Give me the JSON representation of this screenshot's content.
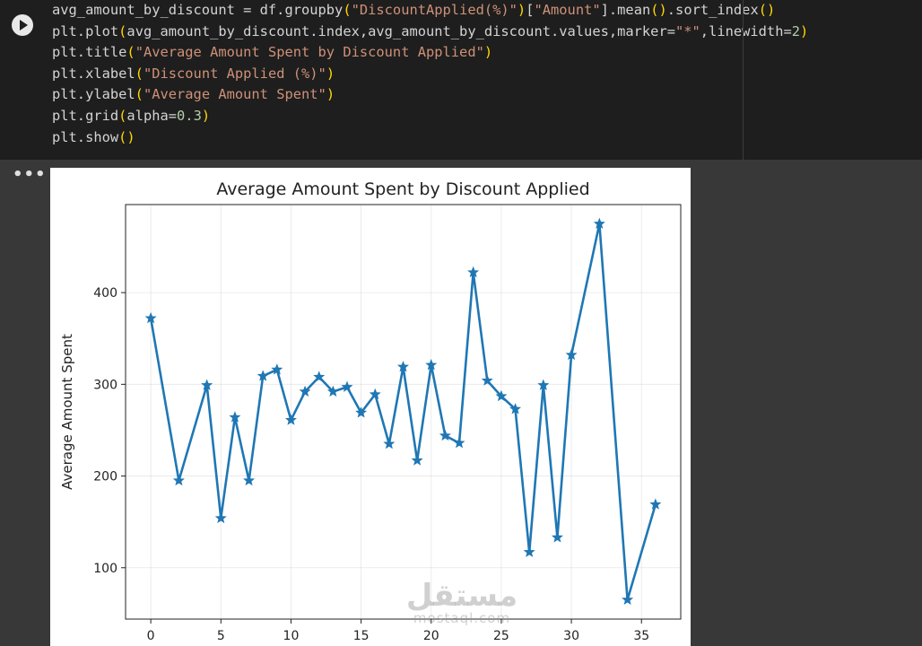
{
  "cell": {
    "code_lines": [
      [
        {
          "t": "avg_amount_by_discount = df.groupby"
        },
        {
          "t": "(",
          "c": "p1"
        },
        {
          "t": "\"DiscountApplied(%)\"",
          "c": "str"
        },
        {
          "t": ")",
          "c": "p1"
        },
        {
          "t": "["
        },
        {
          "t": "\"Amount\"",
          "c": "str"
        },
        {
          "t": "].mean"
        },
        {
          "t": "()",
          "c": "p1"
        },
        {
          "t": ".sort_index"
        },
        {
          "t": "()",
          "c": "p1"
        }
      ],
      [
        {
          "t": "plt.plot"
        },
        {
          "t": "(",
          "c": "p1"
        },
        {
          "t": "avg_amount_by_discount.index,avg_amount_by_discount.values,marker="
        },
        {
          "t": "\"*\"",
          "c": "str"
        },
        {
          "t": ",linewidth="
        },
        {
          "t": "2",
          "c": "num"
        },
        {
          "t": ")",
          "c": "p1"
        }
      ],
      [
        {
          "t": "plt.title"
        },
        {
          "t": "(",
          "c": "p1"
        },
        {
          "t": "\"Average Amount Spent by Discount Applied\"",
          "c": "str"
        },
        {
          "t": ")",
          "c": "p1"
        }
      ],
      [
        {
          "t": "plt.xlabel"
        },
        {
          "t": "(",
          "c": "p1"
        },
        {
          "t": "\"Discount Applied (%)\"",
          "c": "str"
        },
        {
          "t": ")",
          "c": "p1"
        }
      ],
      [
        {
          "t": "plt.ylabel"
        },
        {
          "t": "(",
          "c": "p1"
        },
        {
          "t": "\"Average Amount Spent\"",
          "c": "str"
        },
        {
          "t": ")",
          "c": "p1"
        }
      ],
      [
        {
          "t": "plt.grid"
        },
        {
          "t": "(",
          "c": "p1"
        },
        {
          "t": "alpha="
        },
        {
          "t": "0.3",
          "c": "num"
        },
        {
          "t": ")",
          "c": "p1"
        }
      ],
      [
        {
          "t": "plt.show"
        },
        {
          "t": "()",
          "c": "p1"
        }
      ]
    ]
  },
  "output": {
    "more_label": "•••",
    "watermark_ar": "مستقل",
    "watermark_lat": "mostaql.com"
  },
  "colors": {
    "line": "#1f77b4",
    "grid": "#b0b0b0"
  },
  "chart_data": {
    "type": "line",
    "title": "Average Amount Spent by Discount Applied",
    "xlabel": "",
    "ylabel": "Average Amount Spent",
    "xlim": [
      -1.8,
      37.8
    ],
    "ylim": [
      44,
      496
    ],
    "xticks": [
      0,
      5,
      10,
      15,
      20,
      25,
      30,
      35
    ],
    "yticks": [
      100,
      200,
      300,
      400
    ],
    "grid": true,
    "marker": "*",
    "series": [
      {
        "x": [
          0,
          2,
          4,
          5,
          6,
          7,
          8,
          9,
          10,
          11,
          12,
          13,
          14,
          15,
          16,
          17,
          18,
          19,
          20,
          21,
          22,
          23,
          24,
          25,
          26,
          27,
          28,
          29,
          30,
          32,
          34,
          36
        ],
        "values": [
          372,
          195,
          299,
          154,
          264,
          195,
          309,
          316,
          261,
          292,
          308,
          292,
          297,
          269,
          289,
          235,
          319,
          217,
          321,
          244,
          236,
          422,
          304,
          287,
          273,
          117,
          299,
          133,
          332,
          475,
          65,
          169
        ]
      }
    ]
  }
}
